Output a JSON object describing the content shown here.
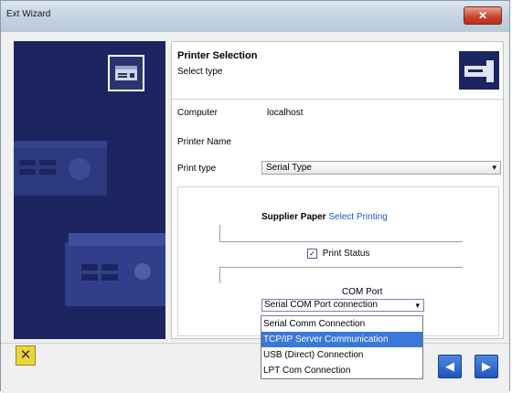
{
  "window": {
    "title": "Ext Wizard",
    "close_glyph": "✕",
    "title_gradient": [
      "#dce6ef",
      "#b8c9d8"
    ]
  },
  "sidebar": {
    "background": "#1c2560",
    "icon": "device-icon",
    "graphic": "device-rack-illustration"
  },
  "header": {
    "title": "Printer Selection",
    "subtitle": "Select type",
    "graphic_icon": "printer-icon"
  },
  "form": {
    "rows": [
      {
        "label": "Computer",
        "value": "localhost"
      },
      {
        "label": "Printer Name",
        "value": ""
      },
      {
        "label": "Print type",
        "value": "Serial Type"
      }
    ],
    "print_type_select": {
      "selected": "Serial Type",
      "arrow": "▾"
    }
  },
  "group": {
    "hint_bold": "Supplier Paper",
    "hint_link": "Select Printing",
    "checkbox_label": "Print Status",
    "checkbox_checked": true,
    "checkbox_glyph": "✓",
    "sub_label": "COM Port",
    "dropdown": {
      "selected": "Serial COM Port connection",
      "arrow": "▾",
      "options": [
        "Serial Comm Connection",
        "TCP/IP Server Communication",
        "USB (Direct) Connection",
        "LPT Com Connection"
      ],
      "highlighted_index": 1
    }
  },
  "footer": {
    "cancel_glyph": "✕",
    "back_glyph": "◀",
    "next_glyph": "▶",
    "cancel_color": "#ecd43d",
    "nav_color": "#1e56bf"
  }
}
